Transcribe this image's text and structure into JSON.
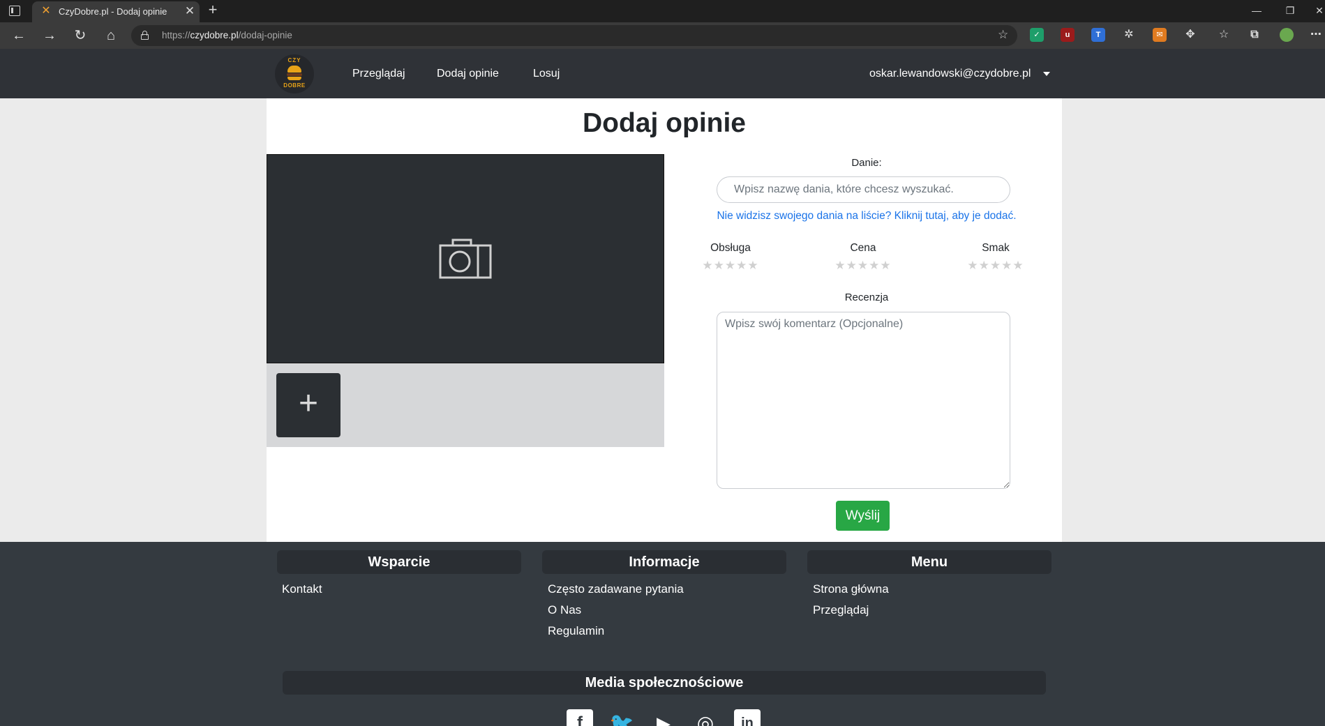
{
  "browser": {
    "tab_title": "CzyDobre.pl - Dodaj opinie",
    "url_scheme": "https://",
    "url_host": "czydobre.pl",
    "url_path": "/dodaj-opinie"
  },
  "navbar": {
    "logo_top": "CZY",
    "logo_bottom": "DOBRE",
    "links": [
      "Przeglądaj",
      "Dodaj opinie",
      "Losuj"
    ],
    "user_email": "oskar.lewandowski@czydobre.pl"
  },
  "page": {
    "title": "Dodaj opinie",
    "dish_label": "Danie:",
    "dish_placeholder": "Wpisz nazwę dania, które chcesz wyszukać.",
    "add_dish_link": "Nie widzisz swojego dania na liście? Kliknij tutaj, aby je dodać.",
    "ratings": [
      {
        "label": "Obsługa",
        "value": 0,
        "max": 5
      },
      {
        "label": "Cena",
        "value": 0,
        "max": 5
      },
      {
        "label": "Smak",
        "value": 0,
        "max": 5
      }
    ],
    "review_label": "Recenzja",
    "review_placeholder": "Wpisz swój komentarz (Opcjonalne)",
    "submit_label": "Wyślij"
  },
  "footer": {
    "columns": [
      {
        "title": "Wsparcie",
        "links": [
          "Kontakt"
        ]
      },
      {
        "title": "Informacje",
        "links": [
          "Często zadawane pytania",
          "O Nas",
          "Regulamin"
        ]
      },
      {
        "title": "Menu",
        "links": [
          "Strona główna",
          "Przeglądaj"
        ]
      }
    ],
    "social_title": "Media społecznościowe",
    "social_icons": [
      "facebook-icon",
      "twitter-icon",
      "youtube-icon",
      "instagram-icon",
      "linkedin-icon"
    ]
  },
  "colors": {
    "navbar_bg": "#2f3237",
    "footer_bg": "#343a40",
    "accent_green": "#28a745",
    "link_blue": "#1a73e8",
    "logo_gold": "#e8a317"
  }
}
